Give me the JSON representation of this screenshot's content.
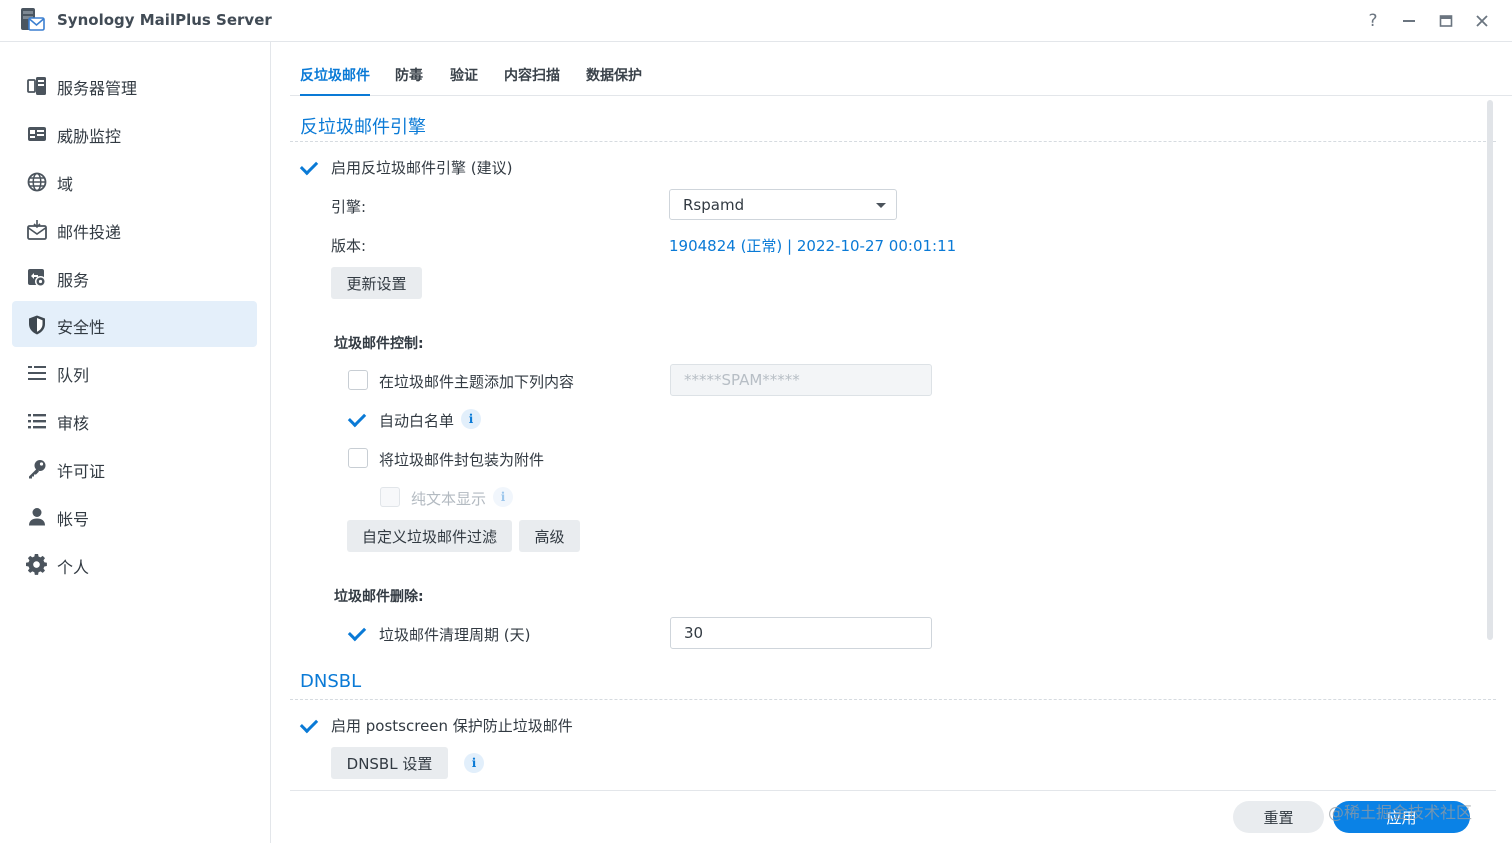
{
  "app": {
    "title": "Synology MailPlus Server"
  },
  "window_controls": {
    "help": "?",
    "minimize": "—",
    "maximize": "▢",
    "close": "✕"
  },
  "sidebar": {
    "items": [
      {
        "label": "服务器管理",
        "icon": "server-manage-icon"
      },
      {
        "label": "威胁监控",
        "icon": "threat-monitor-icon"
      },
      {
        "label": "域",
        "icon": "globe-icon"
      },
      {
        "label": "邮件投递",
        "icon": "mail-delivery-icon"
      },
      {
        "label": "服务",
        "icon": "service-icon"
      },
      {
        "label": "安全性",
        "icon": "shield-icon",
        "active": true
      },
      {
        "label": "队列",
        "icon": "queue-icon"
      },
      {
        "label": "审核",
        "icon": "audit-list-icon"
      },
      {
        "label": "许可证",
        "icon": "key-icon"
      },
      {
        "label": "帐号",
        "icon": "user-icon"
      },
      {
        "label": "个人",
        "icon": "gear-icon"
      }
    ]
  },
  "tabs": [
    {
      "label": "反垃圾邮件",
      "active": true
    },
    {
      "label": "防毒"
    },
    {
      "label": "验证"
    },
    {
      "label": "内容扫描"
    },
    {
      "label": "数据保护"
    }
  ],
  "antispam": {
    "section_title": "反垃圾邮件引擎",
    "enable_label": "启用反垃圾邮件引擎 (建议)",
    "enable_checked": true,
    "engine_label": "引擎:",
    "engine_value": "Rspamd",
    "version_label": "版本:",
    "version_value": "1904824 (正常) | 2022-10-27 00:01:11",
    "update_button": "更新设置",
    "control_title": "垃圾邮件控制:",
    "subject_label": "在垃圾邮件主题添加下列内容",
    "subject_checked": false,
    "subject_value": "*****SPAM*****",
    "whitelist_label": "自动白名单",
    "whitelist_checked": true,
    "attach_label": "将垃圾邮件封包装为附件",
    "attach_checked": false,
    "plaintext_label": "纯文本显示",
    "plaintext_checked": false,
    "custom_filter_button": "自定义垃圾邮件过滤",
    "advanced_button": "高级",
    "delete_title": "垃圾邮件删除:",
    "cleanup_label": "垃圾邮件清理周期 (天)",
    "cleanup_checked": true,
    "cleanup_value": "30"
  },
  "dnsbl": {
    "section_title": "DNSBL",
    "enable_label": "启用 postscreen 保护防止垃圾邮件",
    "enable_checked": true,
    "settings_button": "DNSBL 设置"
  },
  "info_glyph": "i",
  "footer": {
    "reset_button": "重置",
    "apply_button": "应用"
  },
  "watermark": "@稀土掘金技术社区",
  "colors": {
    "accent": "#0a7ad6",
    "active_bg": "#e4effa",
    "primary_button": "#0a82e6"
  }
}
